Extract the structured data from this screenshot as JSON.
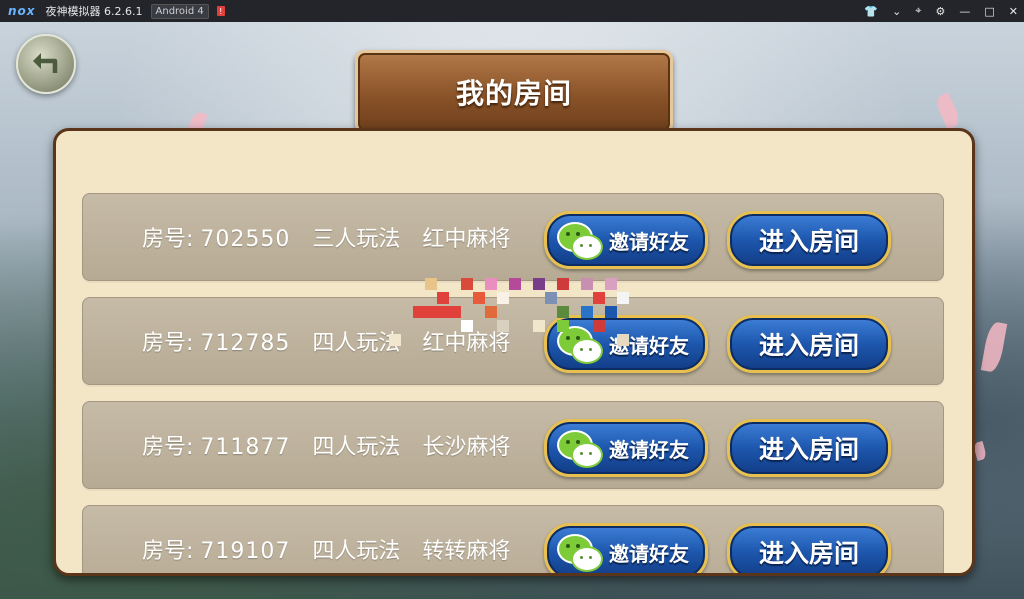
{
  "emulator": {
    "logo": "nox",
    "title": "夜神模拟器 6.2.6.1",
    "android_badge": "Android 4",
    "alert_badge": "!",
    "controls": [
      "shirt-icon",
      "chevron-down-icon",
      "pin-icon",
      "settings-icon",
      "minimize-icon",
      "maximize-icon",
      "close-icon"
    ]
  },
  "game": {
    "page_title": "我的房间",
    "back_icon": "back-arrow-icon",
    "rooms": [
      {
        "label": "房号:",
        "number": "702550",
        "players": "三人玩法",
        "mode": "红中麻将",
        "invite_label": "邀请好友",
        "enter_label": "进入房间"
      },
      {
        "label": "房号:",
        "number": "712785",
        "players": "四人玩法",
        "mode": "红中麻将",
        "invite_label": "邀请好友",
        "enter_label": "进入房间"
      },
      {
        "label": "房号:",
        "number": "711877",
        "players": "四人玩法",
        "mode": "长沙麻将",
        "invite_label": "邀请好友",
        "enter_label": "进入房间"
      },
      {
        "label": "房号:",
        "number": "719107",
        "players": "四人玩法",
        "mode": "转转麻将",
        "invite_label": "邀请好友",
        "enter_label": "进入房间"
      }
    ]
  },
  "colors": {
    "panel": "#f3e6c6",
    "row": "#bcb19b",
    "button_blue": "#1d57ad",
    "button_border": "#e7c04f",
    "plaque": "#8a5329"
  }
}
